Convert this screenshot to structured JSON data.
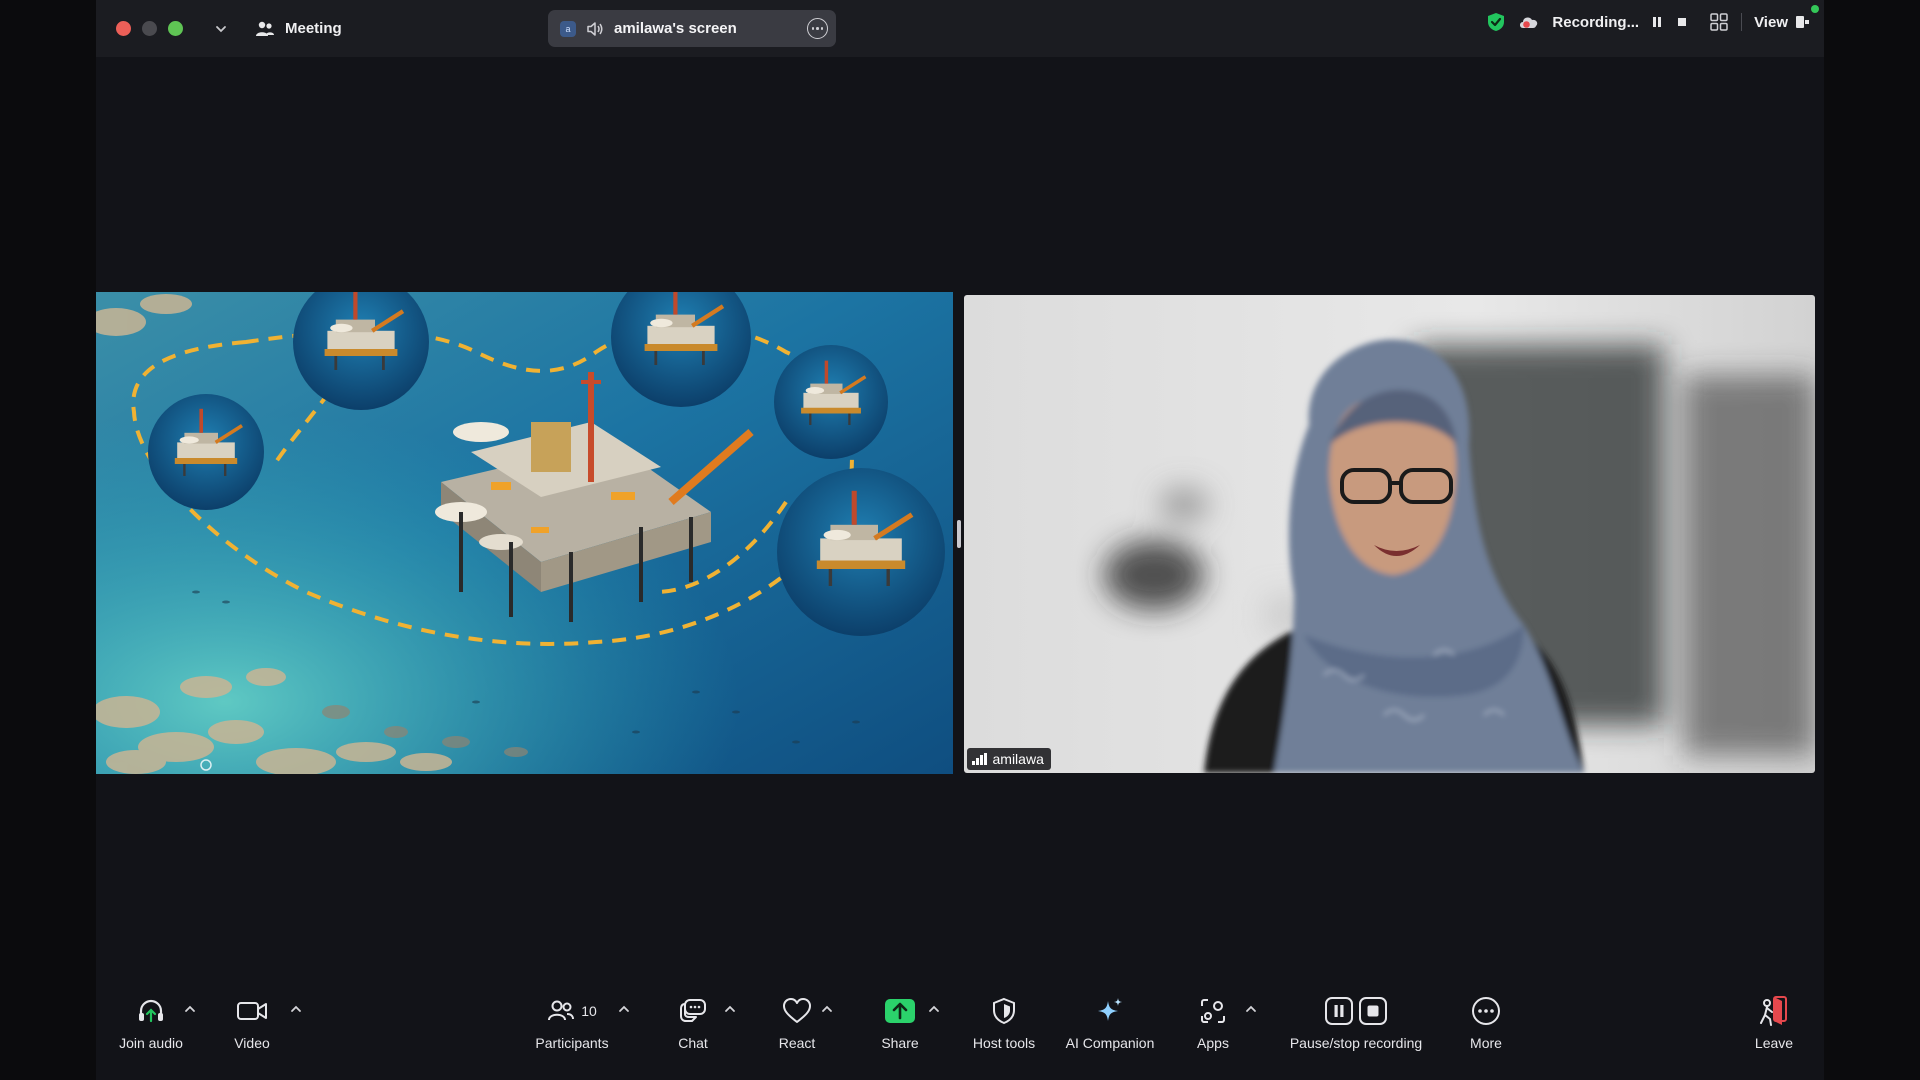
{
  "titlebar": {
    "meeting_label": "Meeting",
    "share_pill": {
      "avatar_letter": "a",
      "title": "amilawa's screen"
    },
    "recording_label": "Recording...",
    "view_label": "View"
  },
  "participant": {
    "name": "amilawa"
  },
  "toolbar": {
    "join_audio": "Join audio",
    "video": "Video",
    "participants": "Participants",
    "participants_count": "10",
    "chat": "Chat",
    "react": "React",
    "share": "Share",
    "host_tools": "Host tools",
    "ai_companion": "AI Companion",
    "apps": "Apps",
    "pause_stop_recording": "Pause/stop recording",
    "more": "More",
    "leave": "Leave"
  },
  "colors": {
    "accent_green": "#22c55e",
    "share_green": "#2bd26b",
    "leave_red": "#e5484d",
    "window_bg": "#121318"
  },
  "icons": [
    "chevron-down-icon",
    "meeting-icon",
    "speaker-icon",
    "more-circle-icon",
    "shield-check-icon",
    "cloud-record-icon",
    "pause-icon",
    "stop-icon",
    "gallery-grid-icon",
    "view-icon",
    "headphone-icon",
    "camera-icon",
    "participants-icon",
    "chat-icon",
    "heart-icon",
    "share-arrow-icon",
    "host-shield-icon",
    "sparkle-icon",
    "apps-icon",
    "pause-stop-icon",
    "more-dots-icon",
    "leave-icon"
  ]
}
